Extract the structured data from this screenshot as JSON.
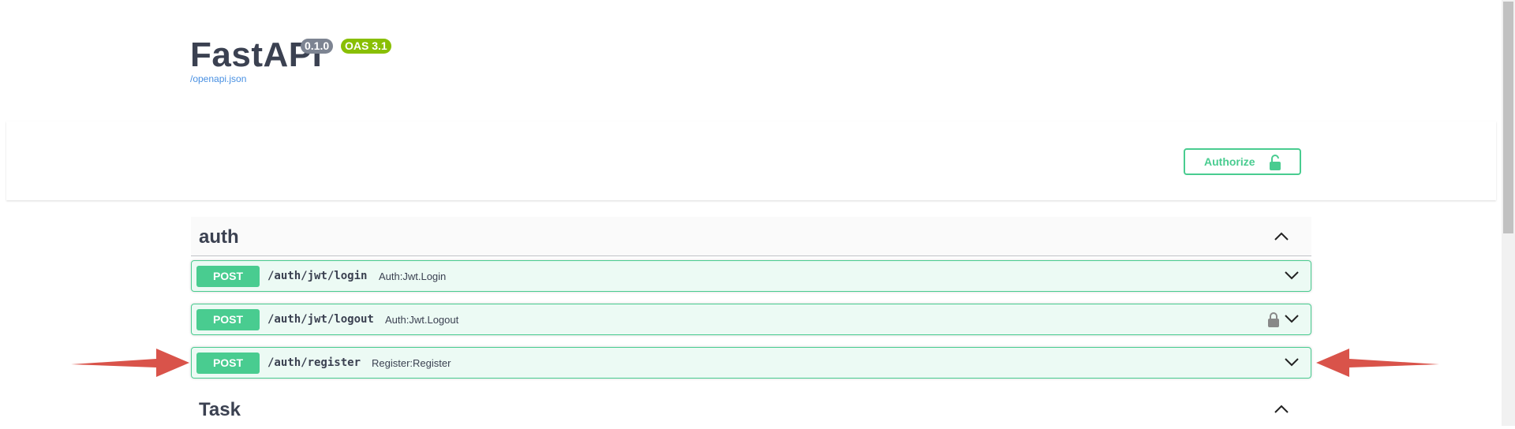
{
  "info": {
    "title": "FastAPI",
    "version_badge": "0.1.0",
    "oas_badge": "OAS 3.1",
    "openapi_link": "/openapi.json"
  },
  "scheme": {
    "authorize_label": "Authorize",
    "lock_icon": "unlocked-padlock-icon"
  },
  "tags": [
    {
      "name": "auth",
      "expanded": true
    },
    {
      "name": "Task",
      "expanded": true
    }
  ],
  "operations": [
    {
      "method": "POST",
      "path": "/auth/jwt/login",
      "summary": "Auth:Jwt.Login",
      "locked": false
    },
    {
      "method": "POST",
      "path": "/auth/jwt/logout",
      "summary": "Auth:Jwt.Logout",
      "locked": true
    },
    {
      "method": "POST",
      "path": "/auth/register",
      "summary": "Register:Register",
      "locked": false
    }
  ],
  "colors": {
    "post_green": "#49cc90",
    "text_dark": "#3b4151",
    "badge_gray": "#7d8492",
    "oas_green": "#89bf04",
    "annotation_red": "#d9534a"
  }
}
